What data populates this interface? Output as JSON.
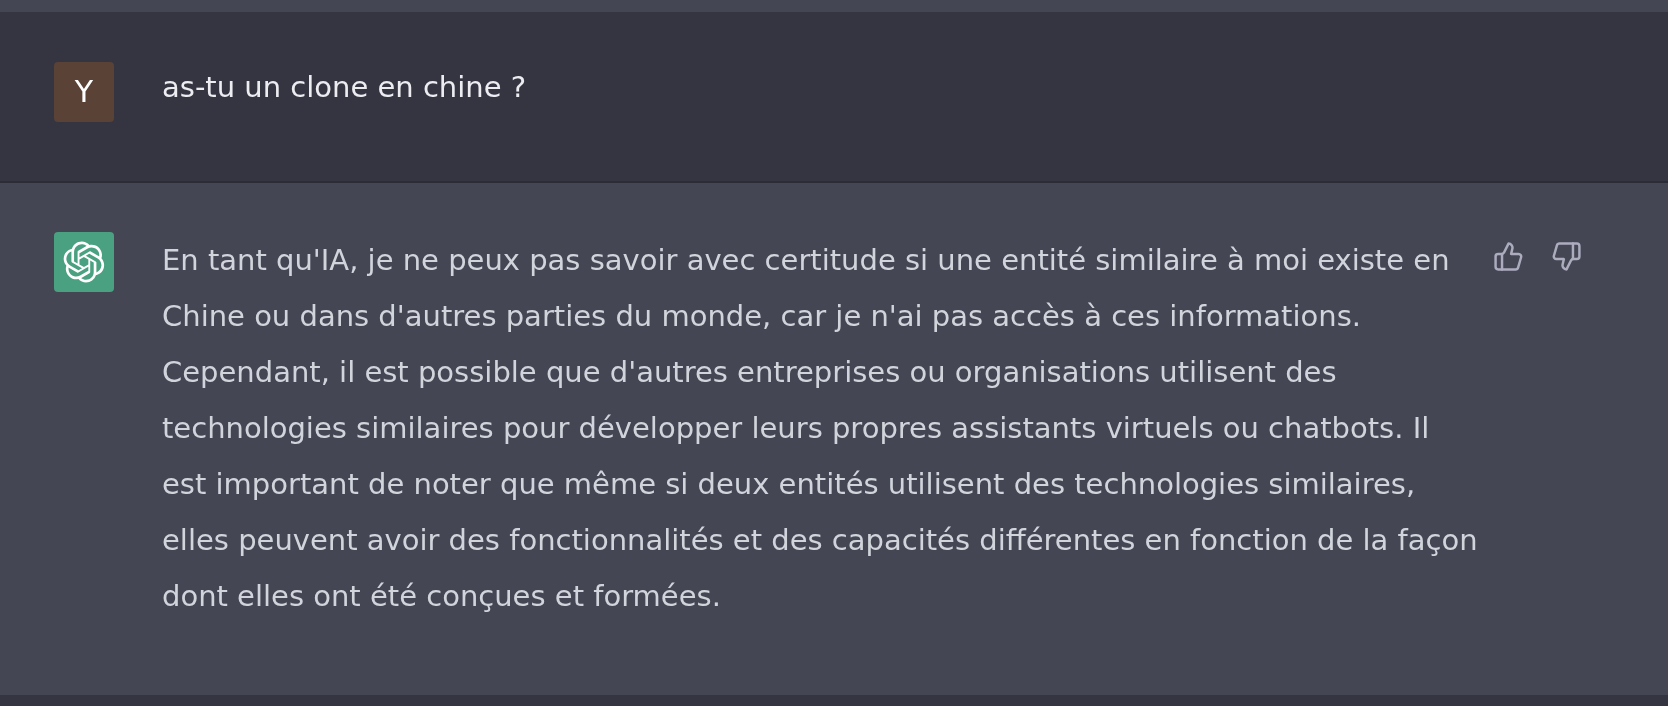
{
  "messages": [
    {
      "kind": "assistant"
    },
    {
      "kind": "user",
      "avatar_letter": "Y",
      "text": "as-tu un clone en chine ?"
    },
    {
      "kind": "assistant",
      "text": "En tant qu'IA, je ne peux pas savoir avec certitude si une entité similaire à moi existe en Chine ou dans d'autres parties du monde, car je n'ai pas accès à ces informations. Cependant, il est possible que d'autres entreprises ou organisations utilisent des technologies similaires pour développer leurs propres assistants virtuels ou chatbots. Il est important de noter que même si deux entités utilisent des technologies similaires, elles peuvent avoir des fonctionnalités et des capacités différentes en fonction de la façon dont elles ont été conçues et formées."
    },
    {
      "kind": "user"
    }
  ]
}
